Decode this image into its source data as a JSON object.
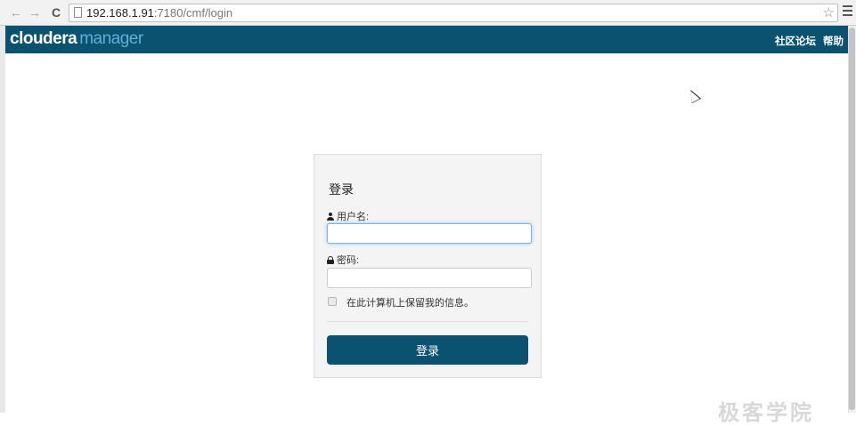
{
  "browser": {
    "url_host": "192.168.1.91",
    "url_path": ":7180/cmf/login"
  },
  "header": {
    "logo_primary": "cloudera",
    "logo_secondary": "manager",
    "links": [
      "社区论坛",
      "帮助"
    ]
  },
  "login": {
    "title": "登录",
    "username_label": "用户名:",
    "username_value": "",
    "password_label": "密码:",
    "password_value": "",
    "remember_label": "在此计算机上保留我的信息。",
    "remember_checked": false,
    "submit_label": "登录"
  },
  "watermark": "极客学院",
  "colors": {
    "header_bg": "#0b5270",
    "button_bg": "#0b5270",
    "logo_accent": "#5fb0d6"
  }
}
